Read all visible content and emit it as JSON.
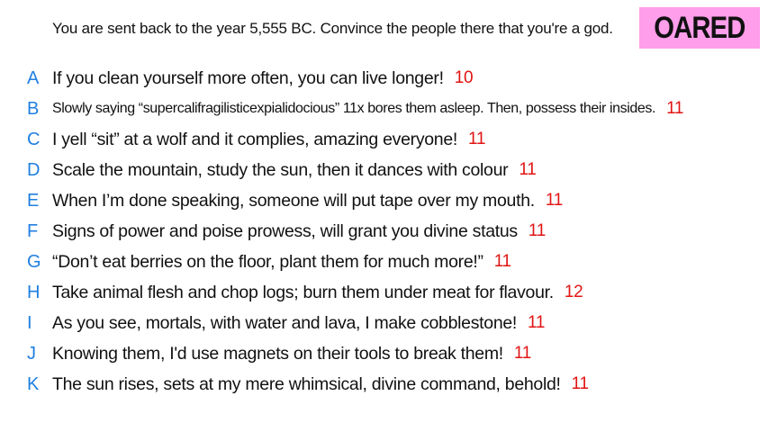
{
  "prompt": "You are sent back to the year 5,555 BC. Convince the people there that you're a god.",
  "badge": {
    "text": "OARED",
    "color": "#ff9eeb"
  },
  "colors": {
    "letter": "#1f7fe0",
    "score": "#e11414"
  },
  "answers": [
    {
      "letter": "A",
      "text": "If you clean yourself more often, you can live longer!",
      "score": "10"
    },
    {
      "letter": "B",
      "text": "Slowly saying “supercalifragilisticexpialidocious” 11x bores them asleep. Then, possess their insides.",
      "score": "11"
    },
    {
      "letter": "C",
      "text": "I yell “sit” at a wolf and it complies, amazing everyone!",
      "score": "11"
    },
    {
      "letter": "D",
      "text": "Scale the mountain, study the sun, then it dances with colour",
      "score": "11"
    },
    {
      "letter": "E",
      "text": "When I’m done speaking, someone will put tape over my mouth.",
      "score": "11"
    },
    {
      "letter": "F",
      "text": "Signs of power and poise prowess, will grant you divine status",
      "score": "11"
    },
    {
      "letter": "G",
      "text": "“Don’t eat berries on the floor, plant them for much more!”",
      "score": "11"
    },
    {
      "letter": "H",
      "text": "Take animal flesh and chop logs; burn them under meat for flavour.",
      "score": "12"
    },
    {
      "letter": "I",
      "text": "As you see, mortals, with water and lava, I make cobblestone!",
      "score": "11"
    },
    {
      "letter": "J",
      "text": "Knowing them, I'd use magnets on their tools to break them!",
      "score": "11"
    },
    {
      "letter": "K",
      "text": "The sun rises, sets at my mere whimsical, divine command, behold!",
      "score": "11"
    }
  ]
}
